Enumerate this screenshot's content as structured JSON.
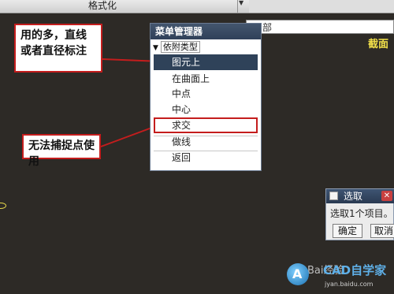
{
  "topbar": {
    "format_label": "格式化"
  },
  "filter": {
    "value": "部"
  },
  "right_text": "截面",
  "callouts": {
    "top": "用的多，直线或者直径标注",
    "bottom": "无法捕捉点使用"
  },
  "menu_manager": {
    "title": "菜单管理器",
    "section_header": "依附类型",
    "items": [
      "图元上",
      "在曲面上",
      "中点",
      "中心",
      "求交",
      "做线",
      "返回"
    ],
    "selected_index": 0,
    "highlighted_index": 4
  },
  "pick_dialog": {
    "title": "选取",
    "message": "选取1个项目。",
    "ok_label": "确定",
    "cancel_label": "取消"
  },
  "watermark": {
    "logo_letter": "A",
    "brand": "CAD自学家",
    "baidu": "Bai经验",
    "url": "jyan.baidu.com"
  },
  "colors": {
    "canvas": "#2d2a26",
    "menu_selected": "#2f4259",
    "callout_border": "#c41d1d",
    "annotation_yellow": "#f2e04a"
  }
}
